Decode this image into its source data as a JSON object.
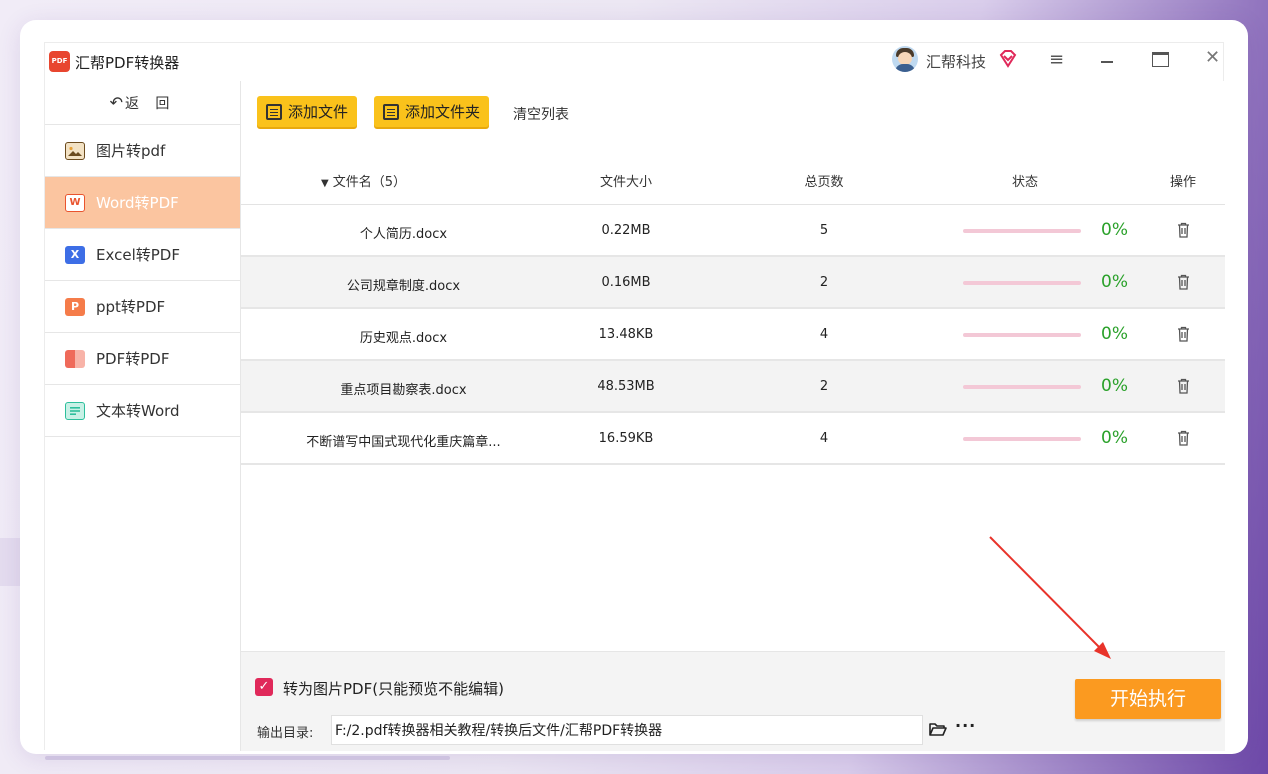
{
  "app": {
    "title": "汇帮PDF转换器",
    "logo_text": "PDF"
  },
  "user": {
    "name": "汇帮科技"
  },
  "colors": {
    "accent": "#fac21b",
    "active_nav": "#fbc5a0",
    "start": "#fb9a20",
    "success": "#2aa12a",
    "checkbox": "#e0295a"
  },
  "sidebar": {
    "back_label": "返 回",
    "items": [
      {
        "label": "图片转pdf",
        "icon": "image-icon",
        "color": "#c8862a"
      },
      {
        "label": "Word转PDF",
        "icon": "word-icon",
        "color": "#e9542e"
      },
      {
        "label": "Excel转PDF",
        "icon": "excel-icon",
        "color": "#3d6ee6"
      },
      {
        "label": "ppt转PDF",
        "icon": "ppt-icon",
        "color": "#f57c4a"
      },
      {
        "label": "PDF转PDF",
        "icon": "pdf-icon",
        "color": "#ef6a5a"
      },
      {
        "label": "文本转Word",
        "icon": "text-icon",
        "color": "#2dbf9c"
      }
    ]
  },
  "toolbar": {
    "add_file": "添加文件",
    "add_folder": "添加文件夹",
    "clear": "清空列表"
  },
  "table": {
    "headers": {
      "name": "文件名（5）",
      "size": "文件大小",
      "pages": "总页数",
      "status": "状态",
      "op": "操作"
    },
    "rows": [
      {
        "name": "个人简历.docx",
        "size": "0.22MB",
        "pages": "5",
        "progress": "0%"
      },
      {
        "name": "公司规章制度.docx",
        "size": "0.16MB",
        "pages": "2",
        "progress": "0%"
      },
      {
        "name": "历史观点.docx",
        "size": "13.48KB",
        "pages": "4",
        "progress": "0%"
      },
      {
        "name": "重点项目勘察表.docx",
        "size": "48.53MB",
        "pages": "2",
        "progress": "0%"
      },
      {
        "name": "不断谱写中国式现代化重庆篇章...",
        "size": "16.59KB",
        "pages": "4",
        "progress": "0%"
      }
    ]
  },
  "bottom": {
    "checkbox_label": "转为图片PDF(只能预览不能编辑)",
    "output_label": "输出目录:",
    "output_path": "F:/2.pdf转换器相关教程/转换后文件/汇帮PDF转换器",
    "start_label": "开始执行"
  }
}
